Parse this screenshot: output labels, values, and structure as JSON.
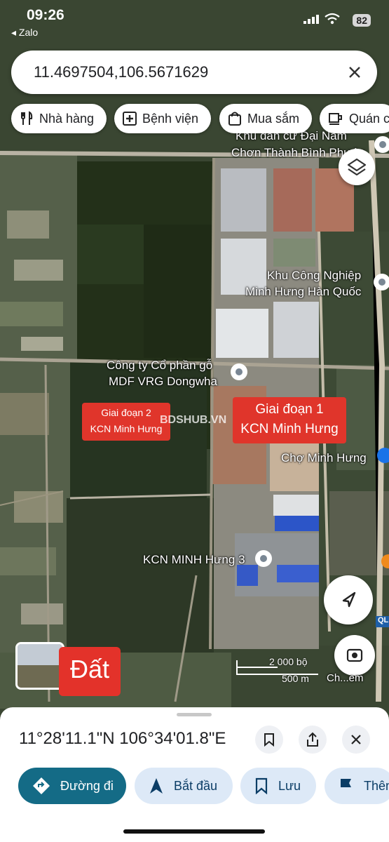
{
  "status": {
    "time": "09:26",
    "back_app": "◂ Zalo",
    "battery": "82"
  },
  "search": {
    "query": "11.4697504,106.5671629"
  },
  "chips": [
    {
      "label": "Nhà hàng",
      "icon": "restaurant-icon"
    },
    {
      "label": "Bệnh viện",
      "icon": "hospital-icon"
    },
    {
      "label": "Mua sắm",
      "icon": "shopping-icon"
    },
    {
      "label": "Quán c",
      "icon": "cafe-icon"
    }
  ],
  "places": {
    "dai_nam_1": "Khu dân cư Đại Nam",
    "dai_nam_2": "Chơn Thành Bình Phước",
    "kcn_hq_1": "Khu Công Nghiệp",
    "kcn_hq_2": "Minh Hưng Hàn Quốc",
    "dongwha_1": "Công ty Cổ phần gỗ",
    "dongwha_2": "MDF VRG Dongwha",
    "cho": "Chợ Minh Hưng",
    "kcn3": "KCN MINH Hưng 3",
    "road_shield": "QL"
  },
  "annotations": {
    "phase2_1": "Giai đoạn 2",
    "phase2_2": "KCN Minh Hưng",
    "phase1_1": "Giai đoạn 1",
    "phase1_2": "KCN Minh Hưng",
    "dat": "Đất",
    "watermark": "BDSHUB.VN"
  },
  "scale": {
    "imperial": "2 000 bộ",
    "metric": "500 m"
  },
  "lens_label": "Ch...em",
  "sheet": {
    "coords": "11°28'11.1\"N 106°34'01.8\"E",
    "actions": [
      {
        "label": "Đường đi",
        "icon": "directions-icon"
      },
      {
        "label": "Bắt đầu",
        "icon": "navigation-arrow-icon"
      },
      {
        "label": "Lưu",
        "icon": "bookmark-icon"
      },
      {
        "label": "Thêm",
        "icon": "flag-icon"
      }
    ]
  },
  "colors": {
    "primary": "#146b86",
    "annotation_red": "#e0352b",
    "chip_bg": "#ffffff"
  }
}
